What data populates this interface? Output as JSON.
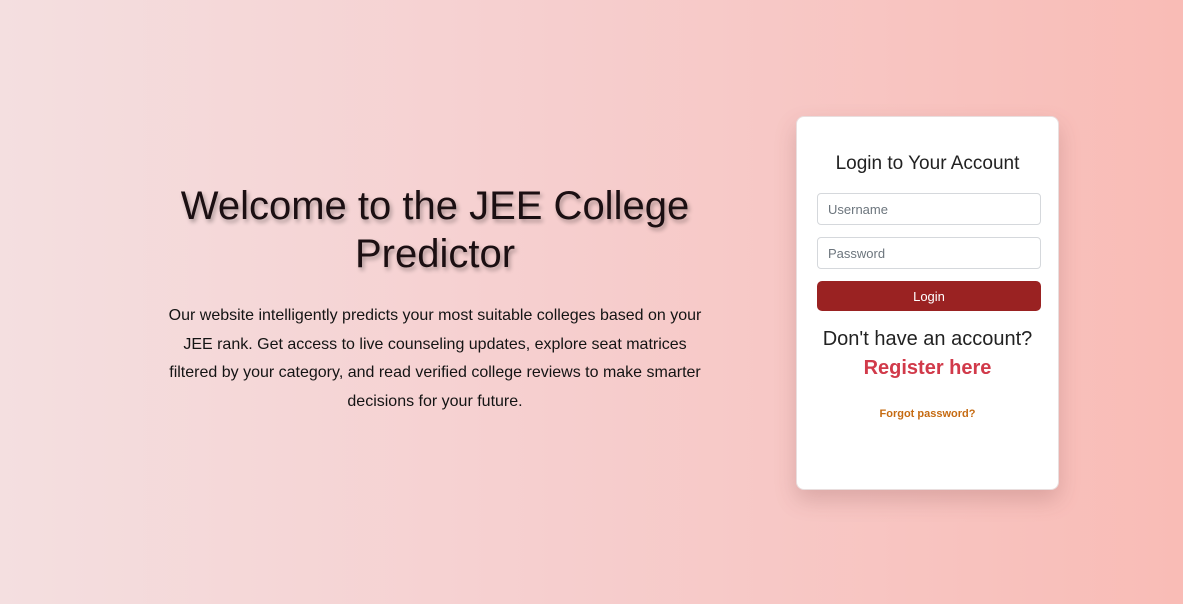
{
  "hero": {
    "title": "Welcome to the JEE College Predictor",
    "description": "Our website intelligently predicts your most suitable colleges based on your JEE rank. Get access to live counseling updates, explore seat matrices filtered by your category, and read verified college reviews to make smarter decisions for your future."
  },
  "login": {
    "title": "Login to Your Account",
    "username_placeholder": "Username",
    "password_placeholder": "Password",
    "button_label": "Login",
    "no_account_text": "Don't have an account?",
    "register_label": "Register here",
    "forgot_label": "Forgot password?"
  },
  "colors": {
    "login_button": "#9a2222",
    "register_link": "#d13a4a",
    "forgot_link": "#c66b12"
  }
}
